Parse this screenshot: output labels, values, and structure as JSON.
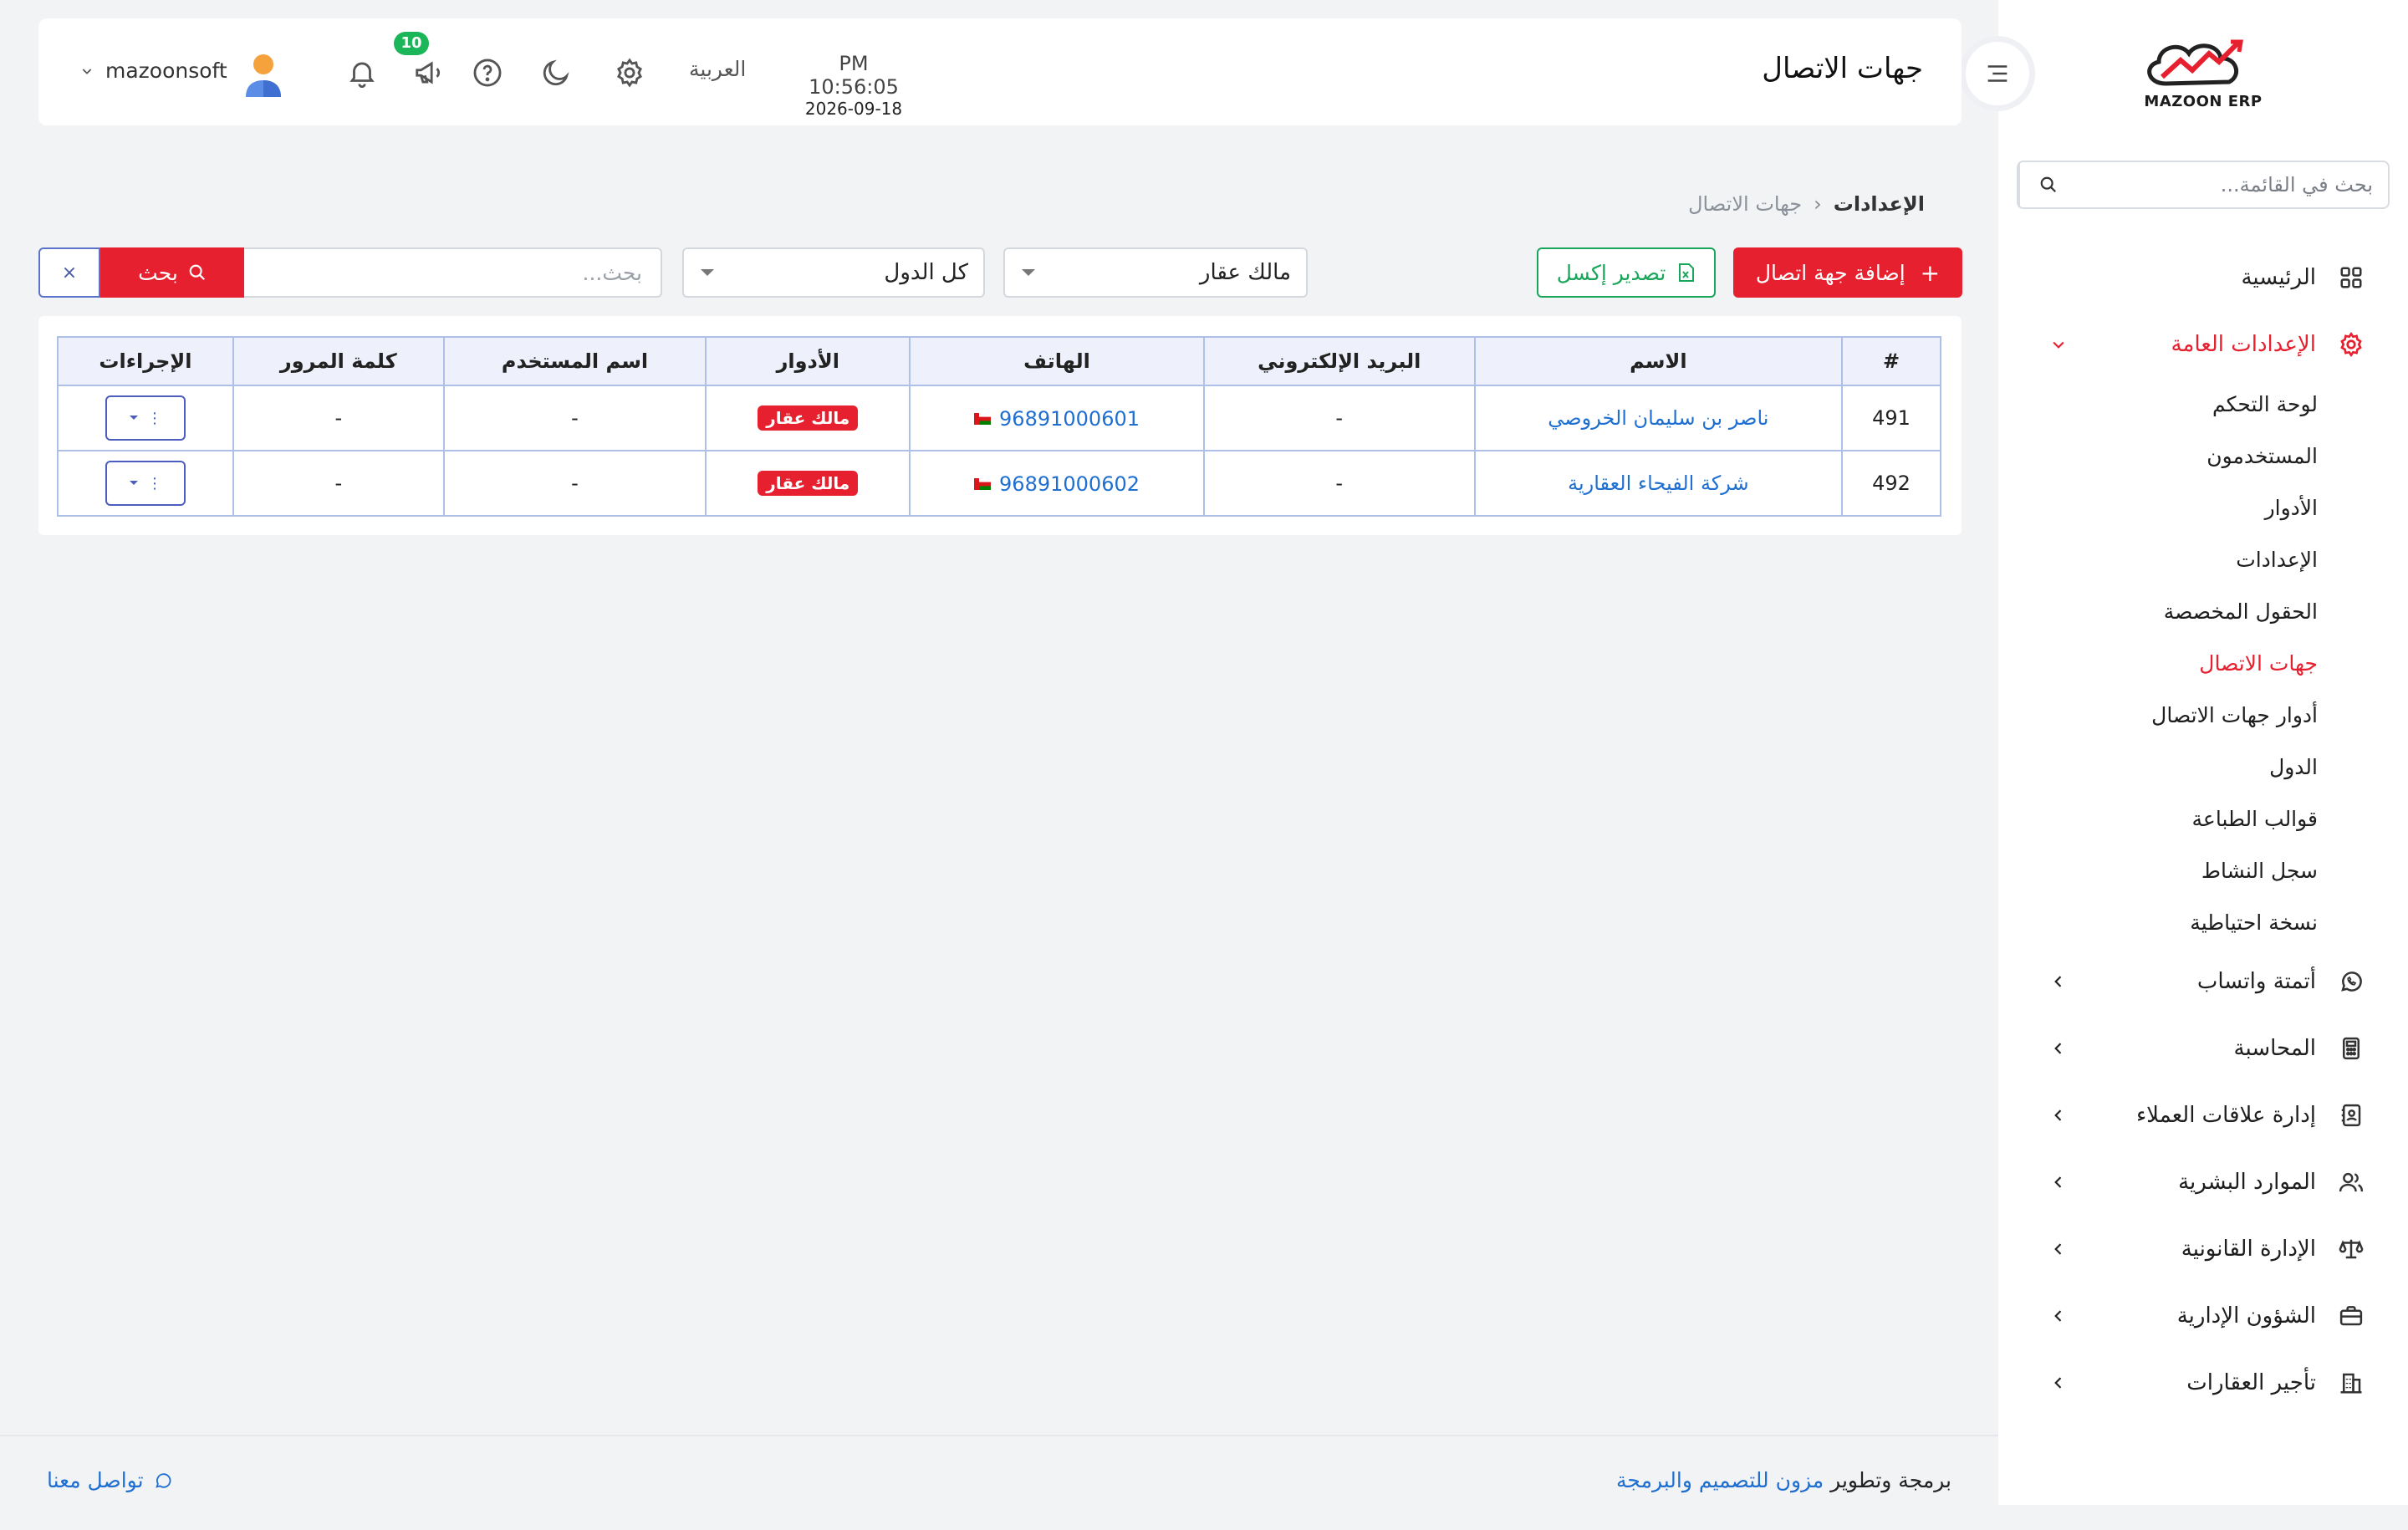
{
  "sidebar": {
    "logo_text": "MAZOON ERP",
    "search_placeholder": "بحث في القائمة...",
    "menu": [
      {
        "label": "الرئيسية",
        "icon": "grid-icon"
      },
      {
        "label": "الإعدادات العامة",
        "icon": "gear-icon",
        "expanded": true,
        "children": [
          "لوحة التحكم",
          "المستخدمون",
          "الأدوار",
          "الإعدادات",
          "الحقول المخصصة",
          "جهات الاتصال",
          "أدوار جهات الاتصال",
          "الدول",
          "قوالب الطباعة",
          "سجل النشاط",
          "نسخة احتياطية"
        ],
        "active_child": "جهات الاتصال"
      },
      {
        "label": "أتمتة واتساب",
        "icon": "whatsapp-icon"
      },
      {
        "label": "المحاسبة",
        "icon": "calculator-icon"
      },
      {
        "label": "إدارة علاقات العملاء",
        "icon": "contacts-book-icon"
      },
      {
        "label": "الموارد البشرية",
        "icon": "users-icon"
      },
      {
        "label": "الإدارة القانونية",
        "icon": "scales-icon"
      },
      {
        "label": "الشؤون الإدارية",
        "icon": "briefcase-icon"
      },
      {
        "label": "تأجير العقارات",
        "icon": "building-icon"
      }
    ]
  },
  "header": {
    "title": "جهات الاتصال",
    "time": "PM 10:56:05",
    "date": "2026-09-18",
    "language": "العربية",
    "notification_count": "10",
    "username": "mazoonsoft"
  },
  "breadcrumb": {
    "root": "الإعدادات",
    "separator": "‹",
    "current": "جهات الاتصال"
  },
  "toolbar": {
    "add_label": "إضافة جهة اتصال",
    "export_label": "تصدير إكسل",
    "role_filter": "مالك عقار",
    "country_filter": "كل الدول",
    "search_placeholder": "بحث...",
    "search_label": "بحث",
    "clear_label": "×"
  },
  "table": {
    "columns": [
      "#",
      "الاسم",
      "البريد الإلكتروني",
      "الهاتف",
      "الأدوار",
      "اسم المستخدم",
      "كلمة المرور",
      "الإجراءات"
    ],
    "rows": [
      {
        "id": "491",
        "name": "ناصر بن سليمان الخروصي",
        "email": "-",
        "phone": "96891000601",
        "role": "مالك عقار",
        "username": "-",
        "password": "-"
      },
      {
        "id": "492",
        "name": "شركة الفيحاء العقارية",
        "email": "-",
        "phone": "96891000602",
        "role": "مالك عقار",
        "username": "-",
        "password": "-"
      }
    ]
  },
  "footer": {
    "credit_prefix": "برمجة وتطوير",
    "credit_link": "مزون للتصميم والبرمجة",
    "contact": "تواصل معنا"
  },
  "colors": {
    "accent": "#e6202e",
    "success": "#19a55a",
    "link": "#1f6fd1",
    "table_border": "#aec0e6"
  }
}
